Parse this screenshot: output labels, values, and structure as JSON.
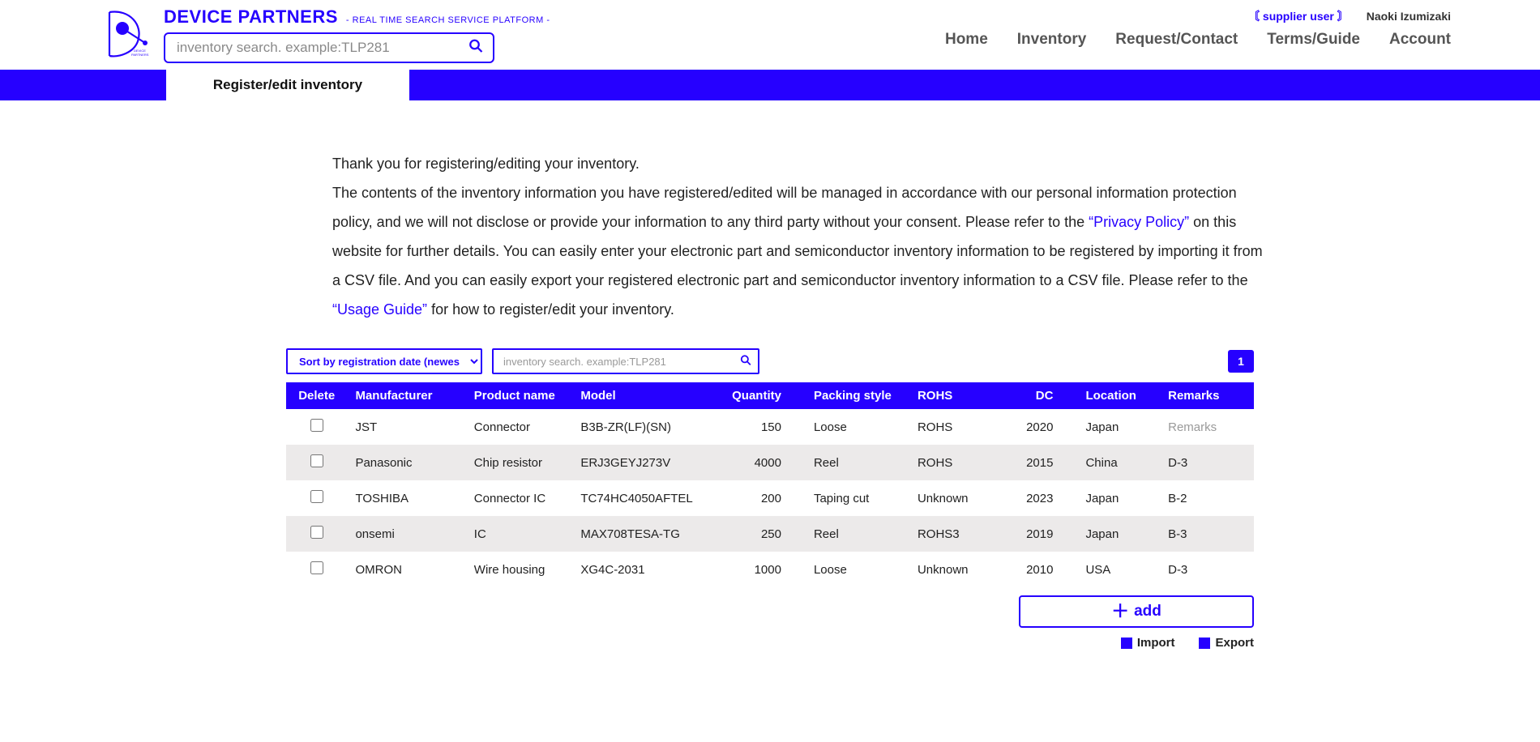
{
  "brand": {
    "title": "DEVICE PARTNERS",
    "subtitle": "- REAL TIME SEARCH SERVICE PLATFORM -"
  },
  "search": {
    "placeholder": "inventory search. example:TLP281"
  },
  "user": {
    "role": "〘 supplier user 〙",
    "name": "Naoki Izumizaki"
  },
  "nav": {
    "home": "Home",
    "inventory": "Inventory",
    "request": "Request/Contact",
    "terms": "Terms/Guide",
    "account": "Account"
  },
  "tab": {
    "title": "Register/edit inventory"
  },
  "intro": {
    "p1": "Thank you for registering/editing your inventory.",
    "p2a": "The contents of the inventory information you have registered/edited will be managed in accordance with our personal information protection policy, and we will not disclose or provide your information to any third party without your consent. Please refer to the ",
    "privacy": "“Privacy Policy”",
    "p2b": " on this website for further details. You can easily enter your electronic part and semiconductor inventory information to be registered by importing it from a CSV file. And you can easily export your registered electronic part and semiconductor inventory information to a CSV file. Please refer to the ",
    "usage": "“Usage Guide”",
    "p2c": " for how to register/edit your inventory."
  },
  "controls": {
    "sort": "Sort by registration date (newest first)",
    "inv_search_placeholder": "inventory search. example:TLP281",
    "page": "1"
  },
  "columns": {
    "delete": "Delete",
    "manufacturer": "Manufacturer",
    "product": "Product name",
    "model": "Model",
    "qty": "Quantity",
    "packing": "Packing style",
    "rohs": "ROHS",
    "dc": "DC",
    "location": "Location",
    "remarks": "Remarks"
  },
  "rows": [
    {
      "manufacturer": "JST",
      "product": "Connector",
      "model": "B3B-ZR(LF)(SN)",
      "qty": "150",
      "packing": "Loose",
      "rohs": "ROHS",
      "dc": "2020",
      "location": "Japan",
      "remarks": "Remarks",
      "remarks_muted": true
    },
    {
      "manufacturer": "Panasonic",
      "product": "Chip resistor",
      "model": "ERJ3GEYJ273V",
      "qty": "4000",
      "packing": "Reel",
      "rohs": "ROHS",
      "dc": "2015",
      "location": "China",
      "remarks": "D-3"
    },
    {
      "manufacturer": "TOSHIBA",
      "product": "Connector IC",
      "model": "TC74HC4050AFTEL",
      "qty": "200",
      "packing": "Taping cut",
      "rohs": "Unknown",
      "dc": "2023",
      "location": "Japan",
      "remarks": "B-2"
    },
    {
      "manufacturer": "onsemi",
      "product": "IC",
      "model": "MAX708TESA-TG",
      "qty": "250",
      "packing": "Reel",
      "rohs": "ROHS3",
      "dc": "2019",
      "location": "Japan",
      "remarks": "B-3"
    },
    {
      "manufacturer": "OMRON",
      "product": "Wire housing",
      "model": "XG4C-2031",
      "qty": "1000",
      "packing": "Loose",
      "rohs": "Unknown",
      "dc": "2010",
      "location": "USA",
      "remarks": "D-3"
    }
  ],
  "actions": {
    "add": "add",
    "import": "Import",
    "export": "Export"
  }
}
